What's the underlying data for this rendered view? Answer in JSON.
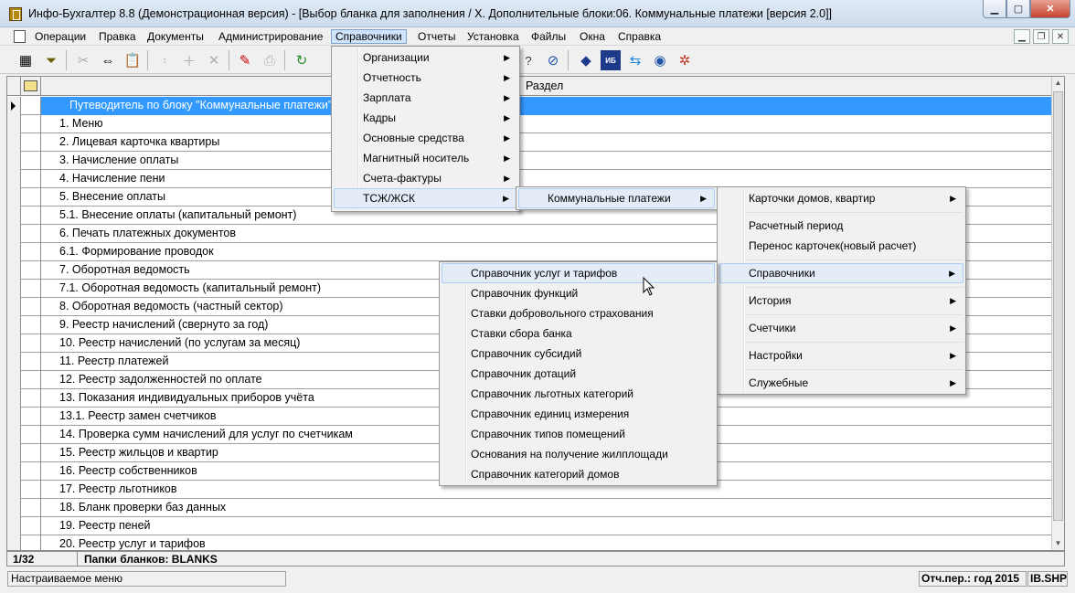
{
  "window": {
    "title": "Инфо-Бухгалтер 8.8 (Демонстрационная версия) - [Выбор бланка для заполнения / X. Дополнительные блоки:06. Коммунальные платежи [версия 2.0]]",
    "controls": [
      "minimize",
      "maximize",
      "close"
    ]
  },
  "menubar": {
    "items": [
      "Операции",
      "Правка",
      "Документы",
      "Администрирование",
      "Справочники",
      "Отчеты",
      "Установка",
      "Файлы",
      "Окна",
      "Справка"
    ],
    "active": "Справочники"
  },
  "toolbar": {
    "icons": [
      "grid-icon",
      "filter-icon",
      "cut-icon",
      "move-icon",
      "paste-icon",
      "sort-icon",
      "add-icon",
      "delete-icon",
      "edit-icon",
      "print-icon",
      "refresh-icon",
      "help-icon",
      "compass-icon",
      "app-icon",
      "ib10-icon",
      "teamviewer-icon",
      "web-icon",
      "network-icon"
    ]
  },
  "grid": {
    "column_header": "Раздел",
    "rows": [
      "Путеводитель по блоку \"Коммунальные платежи\"",
      "1. Меню",
      "2. Лицевая карточка квартиры",
      "3. Начисление оплаты",
      "4. Начисление пени",
      "5. Внесение оплаты",
      "5.1. Внесение оплаты (капитальный ремонт)",
      "6. Печать платежных документов",
      "6.1. Формирование проводок",
      "7. Оборотная ведомость",
      "7.1. Оборотная ведомость (капитальный ремонт)",
      "8. Оборотная ведомость (частный сектор)",
      "9. Реестр начислений (свернуто за год)",
      "10. Реестр начислений (по услугам за месяц)",
      "11. Реестр платежей",
      "12. Реестр задолженностей по оплате",
      "13. Показания индивидуальных приборов учёта",
      "13.1. Реестр замен счетчиков",
      "14. Проверка сумм начислений для услуг по счетчикам",
      "15. Реестр жильцов и квартир",
      "16. Реестр собственников",
      "17. Реестр льготников",
      "18. Бланк проверки баз данных",
      "19. Реестр пеней",
      "20. Реестр услуг и тарифов"
    ],
    "selected_index": 0
  },
  "infobar": {
    "count": "1/32",
    "folder": "Папки бланков: BLANKS"
  },
  "statusbar": {
    "left": "Настраиваемое меню",
    "period": "Отч.пер.: год 2015",
    "file": "IB.SHP"
  },
  "menus": {
    "level1": {
      "items": [
        "Организации",
        "Отчетность",
        "Зарплата",
        "Кадры",
        "Основные средства",
        "Магнитный носитель",
        "Счета-фактуры",
        "ТСЖ/ЖСК"
      ],
      "highlighted": "ТСЖ/ЖСК"
    },
    "level2": {
      "items": [
        "Коммунальные платежи"
      ],
      "highlighted": "Коммунальные платежи"
    },
    "level3": {
      "items": [
        "Карточки домов, квартир",
        "Расчетный период",
        "Перенос карточек(новый расчет)",
        "Справочники",
        "История",
        "Счетчики",
        "Настройки",
        "Служебные"
      ],
      "highlighted": "Справочники"
    },
    "level4": {
      "items": [
        "Справочник услуг и тарифов",
        "Справочник функций",
        "Ставки добровольного страхования",
        "Ставки сбора банка",
        "Справочник субсидий",
        "Справочник дотаций",
        "Справочник льготных категорий",
        "Справочник единиц измерения",
        "Справочник типов помещений",
        "Основания на получение жилплощади",
        "Справочник категорий домов"
      ],
      "highlighted": "Справочник услуг и тарифов"
    }
  },
  "colors": {
    "selection": "#3399ff",
    "menu_highlight": "#e4ecf7"
  }
}
